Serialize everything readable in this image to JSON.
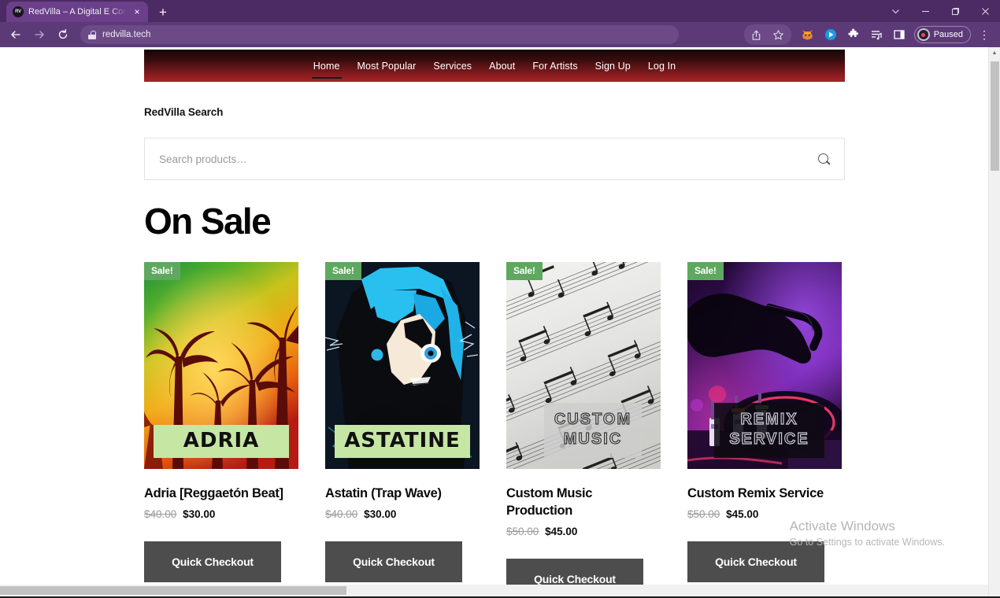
{
  "browser": {
    "tab": {
      "title": "RedVilla – A Digital E Commerce",
      "favicon_text": "RV",
      "close_icon": "×"
    },
    "new_tab_icon": "+",
    "window_controls": {
      "tab_search_icon": "⌄",
      "minimize_icon": "–",
      "maximize_icon": "❐",
      "close_icon": "✕"
    },
    "toolbar": {
      "back_icon": "←",
      "forward_icon": "→",
      "reload_icon": "⟳",
      "url": "redvilla.tech",
      "lock_icon": "lock-icon",
      "share_icon": "share-icon",
      "bookmark_icon": "star-icon",
      "metamask_icon": "fox-icon",
      "extension_blue_icon": "play-badge-icon",
      "extensions_icon": "puzzle-icon",
      "reading_list_icon": "list-icon",
      "side_panel_icon": "side-panel-icon",
      "profile_label": "Paused",
      "menu_icon": "⋮"
    }
  },
  "site": {
    "nav": [
      {
        "label": "Home",
        "active": true
      },
      {
        "label": "Most Popular",
        "active": false
      },
      {
        "label": "Services",
        "active": false
      },
      {
        "label": "About",
        "active": false
      },
      {
        "label": "For Artists",
        "active": false
      },
      {
        "label": "Sign Up",
        "active": false
      },
      {
        "label": "Log In",
        "active": false
      }
    ],
    "search": {
      "label": "RedVilla Search",
      "placeholder": "Search products…",
      "value": "",
      "icon": "search-icon"
    },
    "section_title": "On Sale",
    "badge_label": "Sale!",
    "checkout_label": "Quick Checkout",
    "products": [
      {
        "art_text": "ADRIA",
        "title": "Adria [Reggaetón Beat]",
        "old_price": "$40.00",
        "new_price": "$30.00"
      },
      {
        "art_text": "ASTATINE",
        "title": "Astatin (Trap Wave)",
        "old_price": "$40.00",
        "new_price": "$30.00"
      },
      {
        "art_text": "CUSTOM MUSIC",
        "title": "Custom Music Production",
        "old_price": "$50.00",
        "new_price": "$45.00"
      },
      {
        "art_text": "REMIX SERVICE",
        "title": "Custom Remix Service",
        "old_price": "$50.00",
        "new_price": "$45.00"
      }
    ]
  },
  "watermark": {
    "title": "Activate Windows",
    "subtitle": "Go to Settings to activate Windows."
  },
  "colors": {
    "chrome": "#5c3a78",
    "tabstrip": "#4c2a63",
    "nav_gradient_top": "#150707",
    "nav_gradient_bottom": "#a92427",
    "sale_badge": "#5fa85f",
    "button": "#4d4d4d"
  }
}
